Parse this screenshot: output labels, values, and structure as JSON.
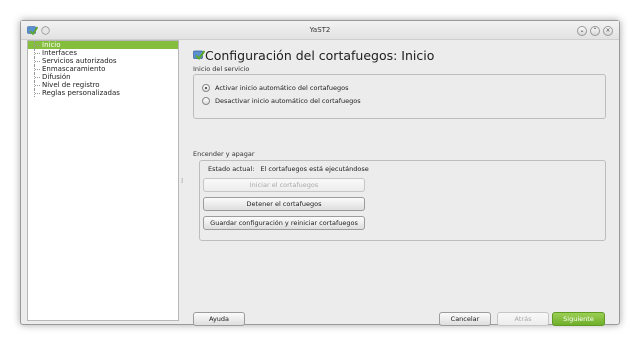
{
  "window": {
    "title": "YaST2",
    "buttons": [
      "chevron-down-icon",
      "chevron-up-icon",
      "close-icon"
    ]
  },
  "sidebar": {
    "items": [
      {
        "label": "Inicio",
        "selected": true
      },
      {
        "label": "Interfaces",
        "selected": false
      },
      {
        "label": "Servicios autorizados",
        "selected": false
      },
      {
        "label": "Enmascaramiento",
        "selected": false
      },
      {
        "label": "Difusión",
        "selected": false
      },
      {
        "label": "Nivel de registro",
        "selected": false
      },
      {
        "label": "Reglas personalizadas",
        "selected": false
      }
    ]
  },
  "main": {
    "title": "Configuración del cortafuegos: Inicio",
    "service_start": {
      "label": "Inicio del servicio",
      "options": [
        {
          "label": "Activar inicio automático del cortafuegos",
          "checked": true
        },
        {
          "label": "Desactivar inicio automático del cortafuegos",
          "checked": false
        }
      ]
    },
    "switch": {
      "label": "Encender y apagar",
      "status_label": "Estado actual:",
      "status_value": "El cortafuegos está ejecutándose",
      "start_button": "Iniciar el cortafuegos",
      "stop_button": "Detener el cortafuegos",
      "save_button": "Guardar configuración y reiniciar cortafuegos"
    }
  },
  "footer": {
    "help": "Ayuda",
    "cancel": "Cancelar",
    "back": "Atrás",
    "next": "Siguiente"
  },
  "colors": {
    "accent": "#84be3c",
    "primary_button": "#7cbc35"
  }
}
